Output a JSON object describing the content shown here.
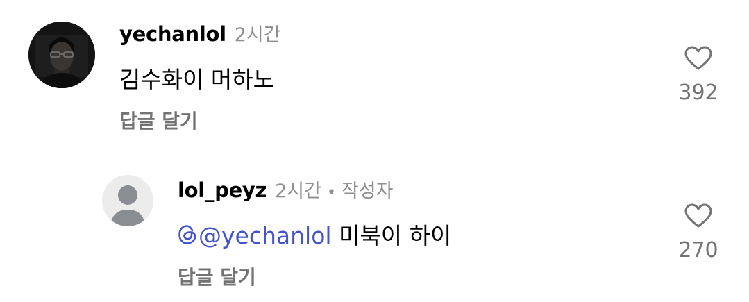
{
  "comments": [
    {
      "username": "yechanlol",
      "time": "2시간",
      "text": "김수화이 머하노",
      "reply_label": "답글 달기",
      "likes": "392",
      "avatar": "profile-photo"
    },
    {
      "username": "lol_peyz",
      "time": "2시간",
      "separator": "•",
      "author_tag": "작성자",
      "mention": "@yechanlol",
      "text": " 미북이 하이",
      "reply_label": "답글 달기",
      "likes": "270",
      "avatar": "default-avatar"
    }
  ],
  "colors": {
    "mention": "#4453c9",
    "muted": "#8e8e8e",
    "reply": "#737373"
  }
}
